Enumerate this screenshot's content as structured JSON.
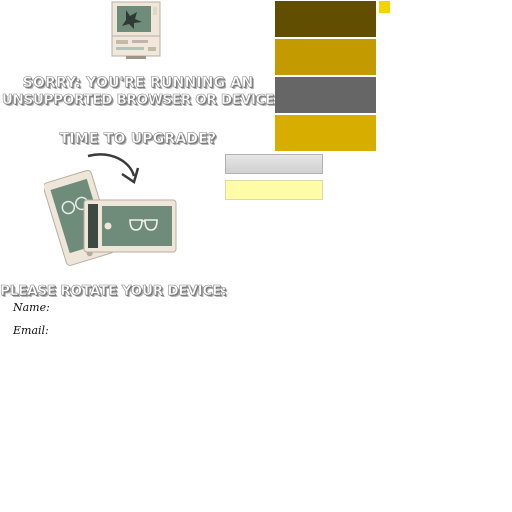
{
  "unsupported": {
    "sorry_line_1": "SORRY: YOU'RE RUNNING AN",
    "sorry_line_2": "UNSUPPORTED BROWSER OR DEVICE",
    "upgrade_prompt": "TIME TO UPGRADE?",
    "computer_icon": "retro-computer-icon",
    "rotate_icon": "rotate-device-icon"
  },
  "rotate": {
    "message": "PLEASE ROTATE YOUR DEVICE:"
  },
  "form": {
    "name_label": "Name:",
    "email_label": "Email:"
  },
  "swatches": {
    "colors": [
      "#624e00",
      "#c39b00",
      "#666666",
      "#d7ad00"
    ],
    "mini": "#f2d500"
  },
  "inputs": {
    "gray_value": "",
    "yellow_value": ""
  }
}
